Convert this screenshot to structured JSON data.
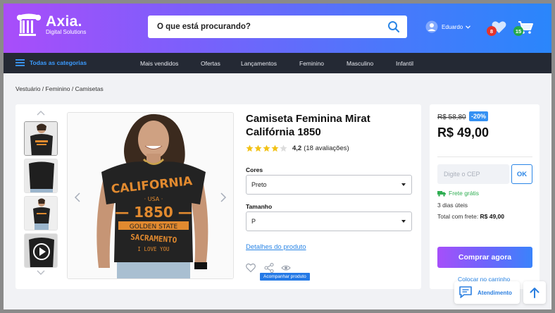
{
  "brand": {
    "name": "Axia.",
    "tagline": "Digital Solutions"
  },
  "search": {
    "placeholder": "O que está procurando?"
  },
  "user": {
    "name": "Eduardo"
  },
  "wishlist": {
    "count": "8"
  },
  "cart": {
    "count": "15"
  },
  "nav": {
    "all_categories": "Todas as categorias",
    "items": [
      "Mais vendidos",
      "Ofertas",
      "Lançamentos",
      "Feminino",
      "Masculino",
      "Infantil"
    ]
  },
  "breadcrumb": "Vestuário / Feminino / Camisetas",
  "product": {
    "title": "Camiseta Feminina Mirat Califórnia 1850",
    "rating": "4,2",
    "reviews": "(18 avaliações)",
    "stars_filled": 4,
    "colors_label": "Cores",
    "color_value": "Preto",
    "size_label": "Tamanho",
    "size_value": "P",
    "details_link": "Detalhes do produto",
    "follow_tooltip": "Acompanhar produto"
  },
  "pricing": {
    "old_price": "R$ 58,80",
    "discount": "-20%",
    "price": "R$ 49,00",
    "cep_placeholder": "Digite o CEP",
    "ok_label": "OK",
    "free_shipping": "Frete grátis",
    "delivery": "3 dias úteis",
    "total_label": "Total com frete:",
    "total_value": "R$ 49,00",
    "buy_label": "Comprar agora",
    "add_to_cart": "Colocar no carrinho"
  },
  "support": {
    "label": "Atendimento"
  },
  "colors": {
    "accent_blue": "#2b86e6",
    "gradient_start": "#a94dfa",
    "gradient_end": "#2a86fb",
    "nav_bg": "#242934",
    "green": "#2fae52",
    "badge_red": "#e5332a"
  }
}
